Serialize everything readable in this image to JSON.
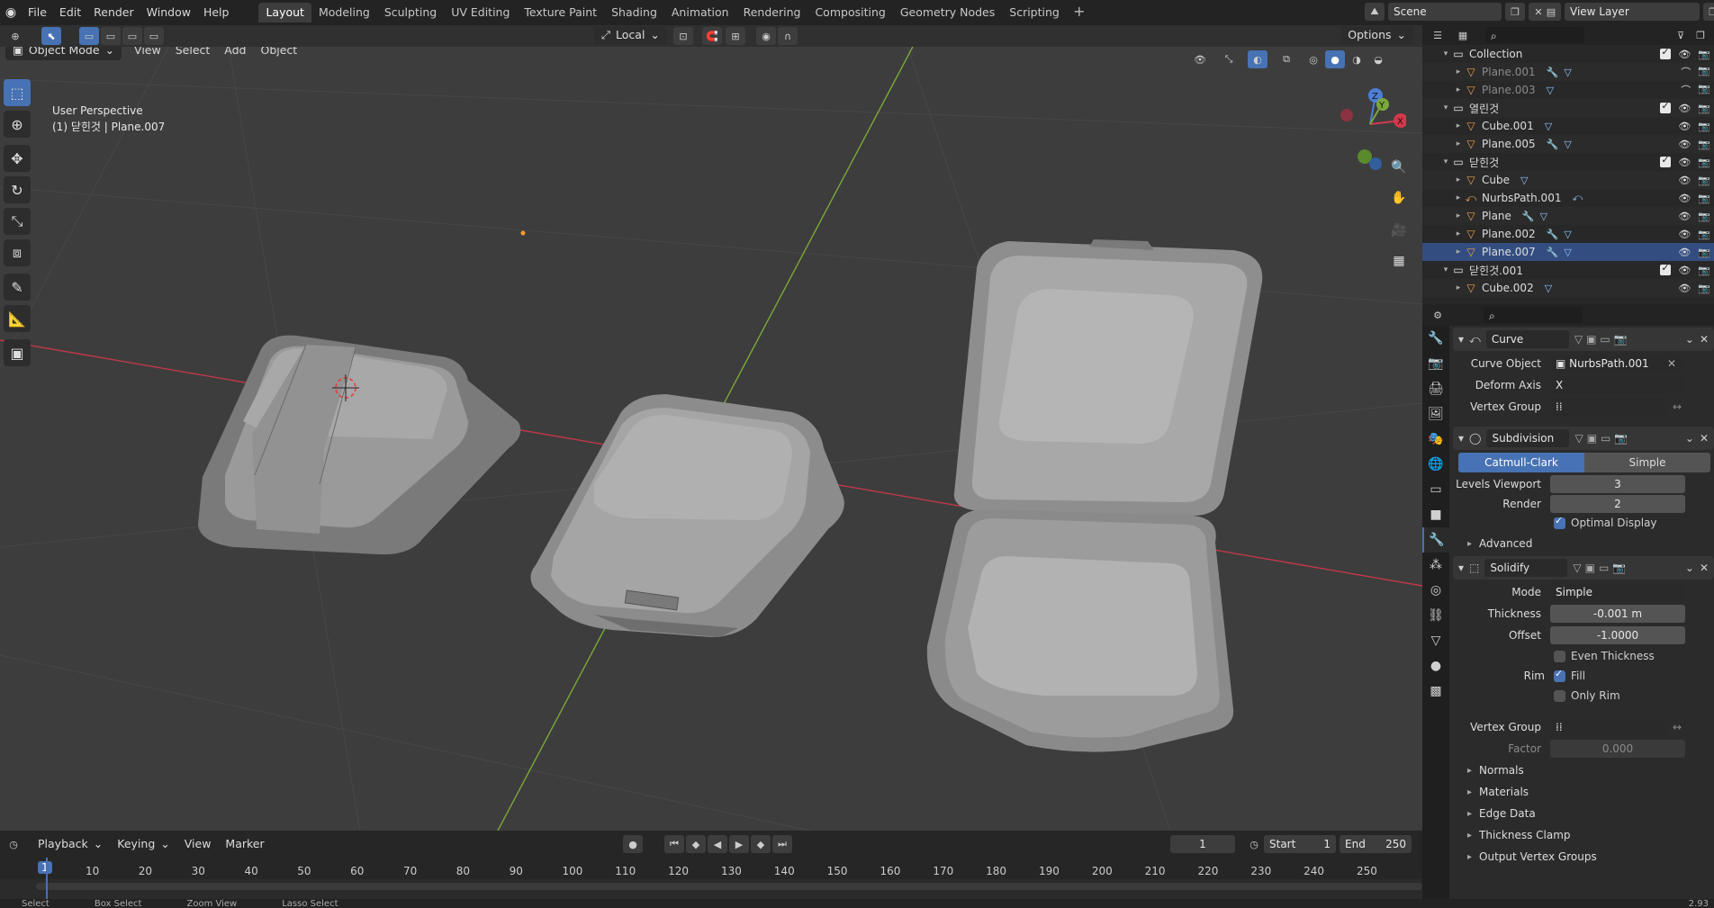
{
  "topbar": {
    "menus": [
      "File",
      "Edit",
      "Render",
      "Window",
      "Help"
    ],
    "workspaces": [
      "Layout",
      "Modeling",
      "Sculpting",
      "UV Editing",
      "Texture Paint",
      "Shading",
      "Animation",
      "Rendering",
      "Compositing",
      "Geometry Nodes",
      "Scripting"
    ],
    "active_workspace": "Layout",
    "scene": "Scene",
    "view_layer": "View Layer"
  },
  "viewport": {
    "mode": "Object Mode",
    "menus": [
      "View",
      "Select",
      "Add",
      "Object"
    ],
    "transform_orientation": "Local",
    "options_label": "Options",
    "info_line1": "User Perspective",
    "info_line2": "(1) 닫힌것 | Plane.007",
    "gizmo_axes": {
      "z": "Z",
      "y": "Y",
      "x": "X"
    }
  },
  "outliner": {
    "rows": [
      {
        "type": "collection",
        "name": "Collection",
        "level": 0
      },
      {
        "type": "mesh",
        "name": "Plane.001",
        "level": 1,
        "dim": true,
        "mods": "🔧▽"
      },
      {
        "type": "mesh",
        "name": "Plane.003",
        "level": 1,
        "dim": true,
        "mods": "▽"
      },
      {
        "type": "collection",
        "name": "열린것",
        "level": 0
      },
      {
        "type": "mesh",
        "name": "Cube.001",
        "level": 1,
        "mods": "▽"
      },
      {
        "type": "mesh",
        "name": "Plane.005",
        "level": 1,
        "mods": "🔧▽"
      },
      {
        "type": "collection",
        "name": "닫힌것",
        "level": 0
      },
      {
        "type": "mesh",
        "name": "Cube",
        "level": 1,
        "mods": "▽"
      },
      {
        "type": "curve",
        "name": "NurbsPath.001",
        "level": 1,
        "mods": "⤺"
      },
      {
        "type": "mesh",
        "name": "Plane",
        "level": 1,
        "mods": "🔧▽"
      },
      {
        "type": "mesh",
        "name": "Plane.002",
        "level": 1,
        "mods": "🔧▽"
      },
      {
        "type": "mesh",
        "name": "Plane.007",
        "level": 1,
        "mods": "🔧▽",
        "active": true
      },
      {
        "type": "collection",
        "name": "닫힌것.001",
        "level": 0
      },
      {
        "type": "mesh",
        "name": "Cube.002",
        "level": 1,
        "mods": "▽"
      }
    ]
  },
  "properties": {
    "curve_mod": {
      "name": "Curve",
      "curve_object_label": "Curve Object",
      "curve_object": "NurbsPath.001",
      "deform_axis_label": "Deform Axis",
      "deform_axis": "X",
      "vertex_group_label": "Vertex Group"
    },
    "subdiv_mod": {
      "name": "Subdivision",
      "mode_a": "Catmull-Clark",
      "mode_b": "Simple",
      "levels_viewport_label": "Levels Viewport",
      "levels_viewport": "3",
      "render_label": "Render",
      "render": "2",
      "optimal_display": "Optimal Display",
      "advanced": "Advanced"
    },
    "solidify_mod": {
      "name": "Solidify",
      "mode_label": "Mode",
      "mode": "Simple",
      "thickness_label": "Thickness",
      "thickness": "-0.001 m",
      "offset_label": "Offset",
      "offset": "-1.0000",
      "even_thickness": "Even Thickness",
      "rim_label": "Rim",
      "fill": "Fill",
      "only_rim": "Only Rim",
      "vertex_group_label": "Vertex Group",
      "factor_label": "Factor",
      "factor": "0.000",
      "subpanels": [
        "Normals",
        "Materials",
        "Edge Data",
        "Thickness Clamp",
        "Output Vertex Groups"
      ]
    }
  },
  "timeline": {
    "menus": [
      "Playback",
      "Keying",
      "View",
      "Marker"
    ],
    "current_frame": "1",
    "start_label": "Start",
    "start": "1",
    "end_label": "End",
    "end": "250",
    "ticks": [
      "1",
      "10",
      "20",
      "30",
      "40",
      "50",
      "60",
      "70",
      "80",
      "90",
      "100",
      "110",
      "120",
      "130",
      "140",
      "150",
      "160",
      "170",
      "180",
      "190",
      "200",
      "210",
      "220",
      "230",
      "240",
      "250"
    ]
  },
  "statusbar": {
    "items": [
      "Select",
      "Box Select",
      "Zoom View",
      "Lasso Select"
    ],
    "version": "2.93"
  },
  "colors": {
    "accent": "#4772b3",
    "viewport_bg": "#3d3d3d",
    "x_axis": "#c0394b",
    "y_axis": "#7aa83a",
    "mesh_icon": "#e8a04d",
    "collection_icon": "#e6e6e6"
  }
}
